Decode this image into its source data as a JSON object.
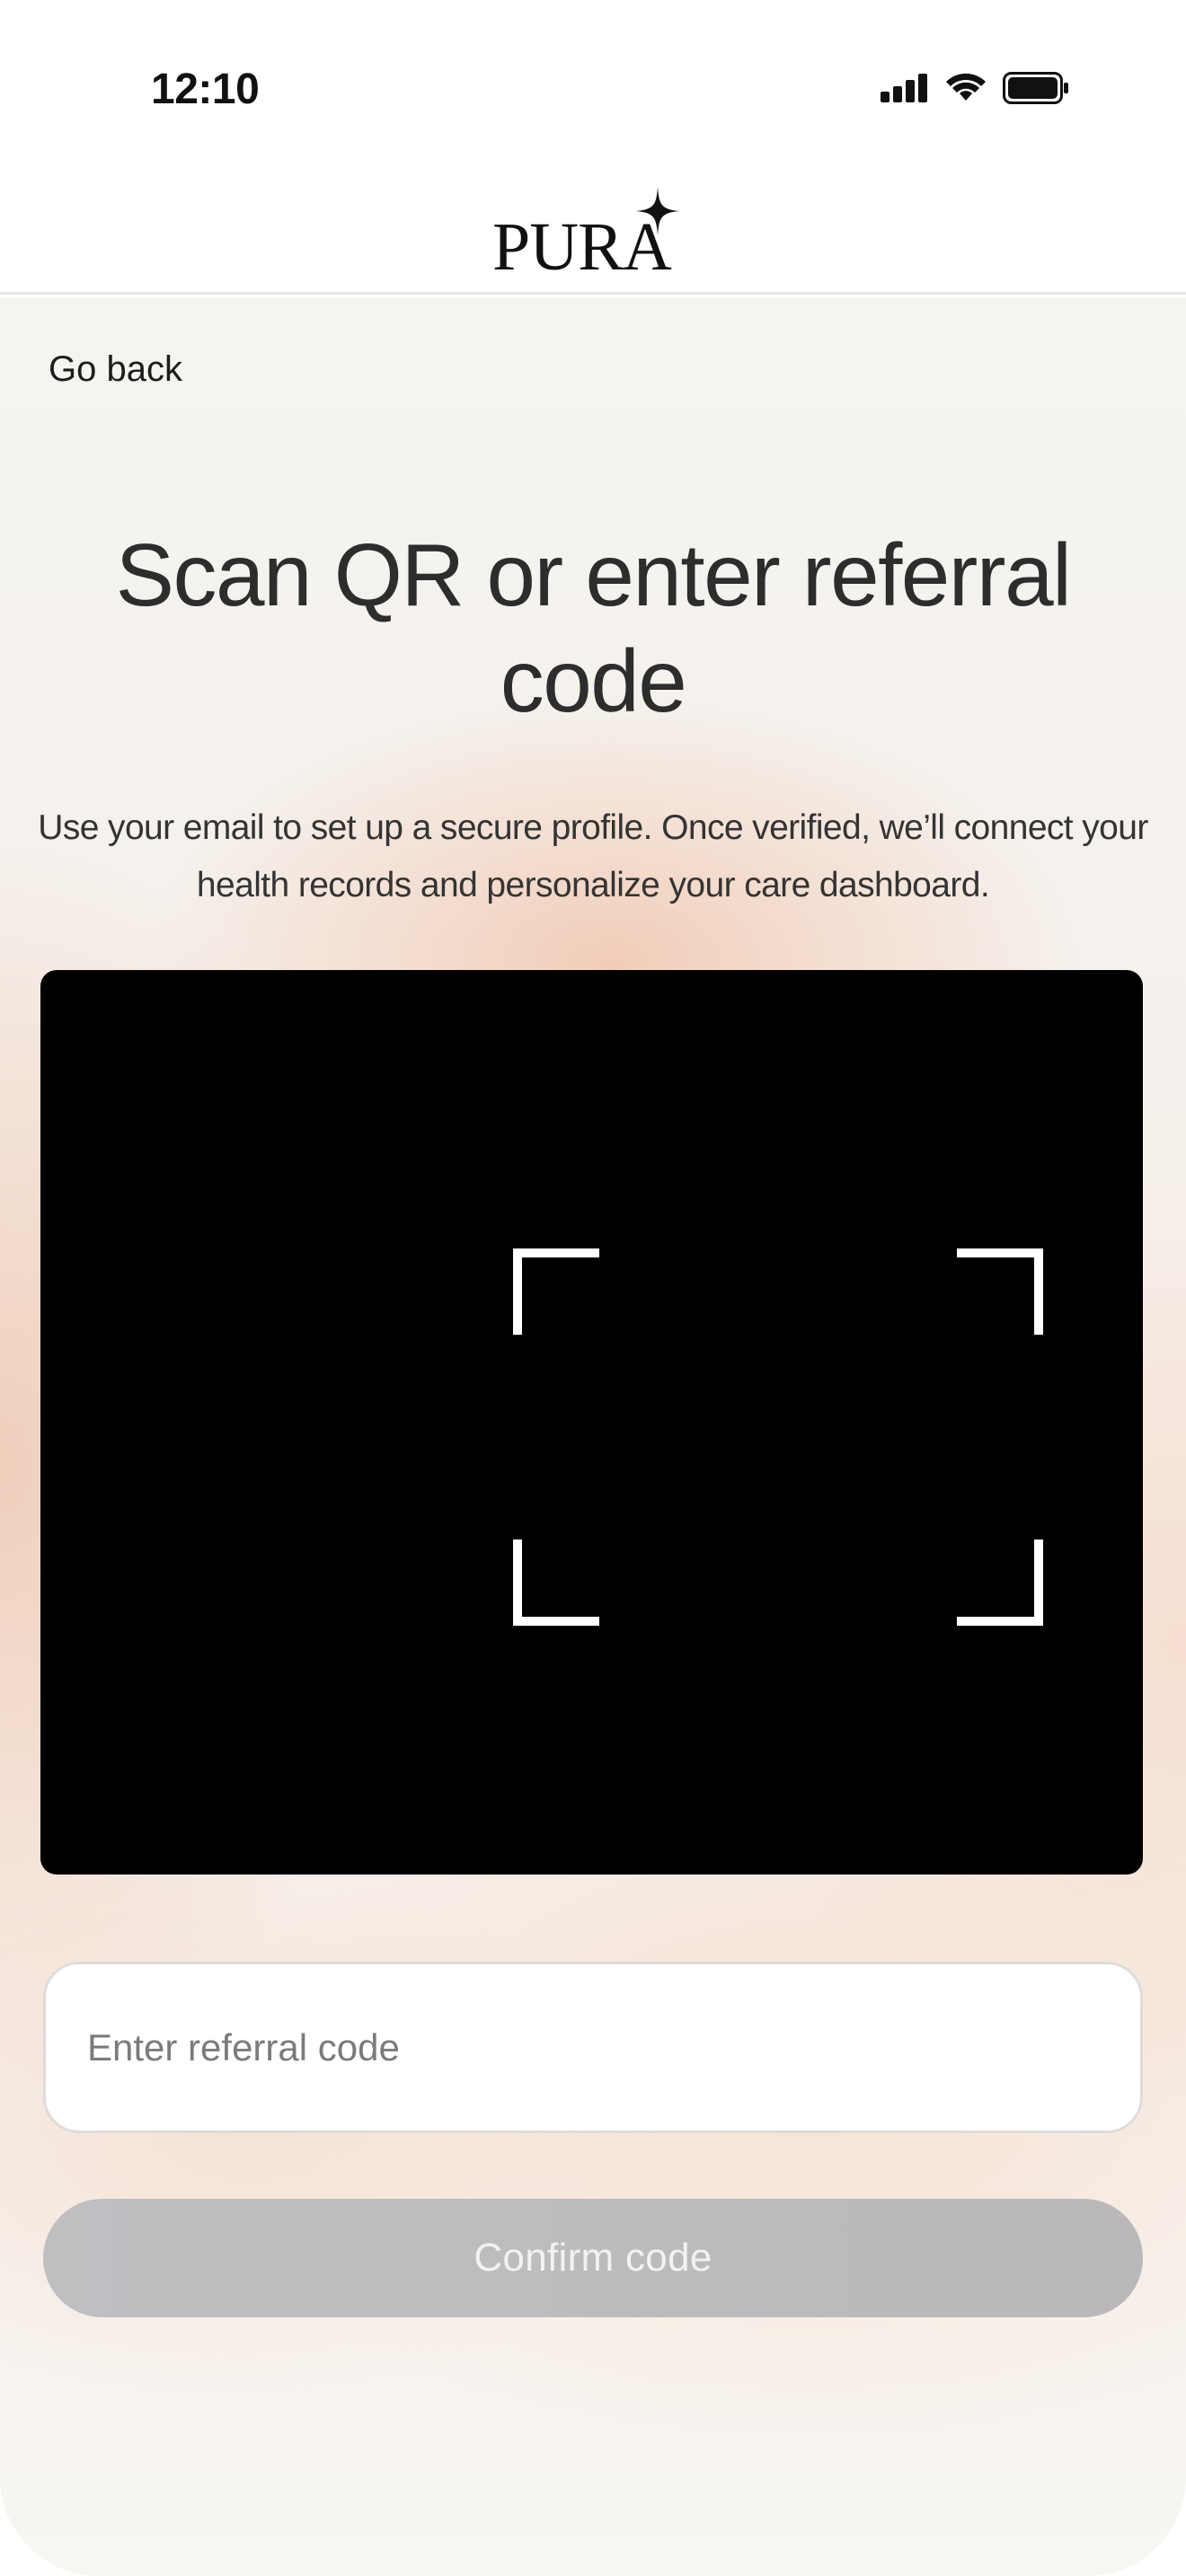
{
  "status_bar": {
    "time": "12:10",
    "icons": [
      "cellular-signal-icon",
      "wifi-icon",
      "battery-icon"
    ]
  },
  "header": {
    "logo_text": "PURA",
    "logo_icon": "sparkle-star-icon"
  },
  "navigation": {
    "back_label": "Go back"
  },
  "main": {
    "title": "Scan QR or enter referral code",
    "subtitle": "Use your email to set up a secure profile. Once verified, we’ll connect your health records and personalize your care dashboard."
  },
  "scanner": {
    "state": "camera-viewfinder",
    "frame_color": "#ffffff",
    "background_color": "#000000"
  },
  "referral": {
    "placeholder": "Enter referral code",
    "value": ""
  },
  "confirm": {
    "label": "Confirm code",
    "enabled": false
  },
  "colors": {
    "title_text": "#2d2d2d",
    "button_disabled": "#bdbcbe",
    "button_text": "#f2f2f2",
    "warm_accent": "#f1c7b0"
  }
}
